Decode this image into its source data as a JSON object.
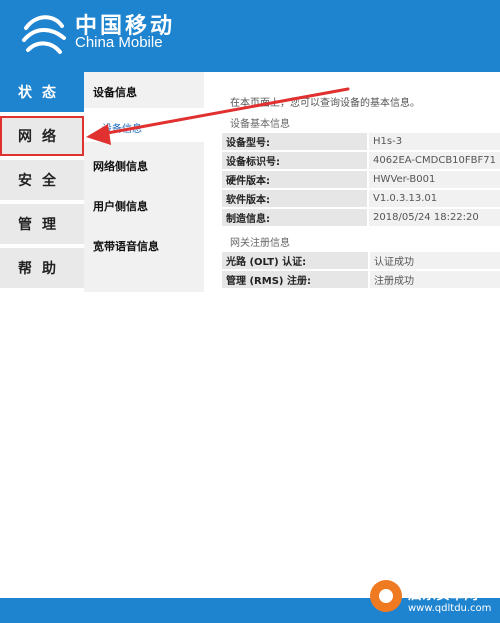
{
  "header": {
    "logo_cn": "中国移动",
    "logo_en": "China Mobile",
    "color": "#1f84cf"
  },
  "nav": {
    "items": [
      {
        "label": "状态",
        "active": true
      },
      {
        "label": "网络",
        "highlight": true
      },
      {
        "label": "安全"
      },
      {
        "label": "管理"
      },
      {
        "label": "帮助"
      }
    ]
  },
  "subnav": {
    "items": [
      {
        "label": "设备信息"
      },
      {
        "label": "设备信息",
        "child": true
      },
      {
        "label": "网络侧信息"
      },
      {
        "label": "用户侧信息"
      },
      {
        "label": "宽带语音信息"
      }
    ]
  },
  "content": {
    "intro": "在本页面上，您可以查询设备的基本信息。",
    "basic_title": "设备基本信息",
    "basic_rows": [
      {
        "key": "设备型号:",
        "value": "H1s-3"
      },
      {
        "key": "设备标识号:",
        "value": "4062EA-CMDCB10FBF71"
      },
      {
        "key": "硬件版本:",
        "value": "HWVer-B001"
      },
      {
        "key": "软件版本:",
        "value": "V1.0.3.13.01"
      },
      {
        "key": "制造信息:",
        "value": "2018/05/24 18:22:20"
      }
    ],
    "reg_title": "网关注册信息",
    "reg_rows": [
      {
        "key": "光路 (OLT) 认证:",
        "value": "认证成功"
      },
      {
        "key": "管理 (RMS) 注册:",
        "value": "注册成功"
      }
    ]
  },
  "annotation": {
    "arrow_color": "#e0302f"
  },
  "watermark": {
    "text": "启东安卓网",
    "url": "www.qdltdu.com"
  }
}
